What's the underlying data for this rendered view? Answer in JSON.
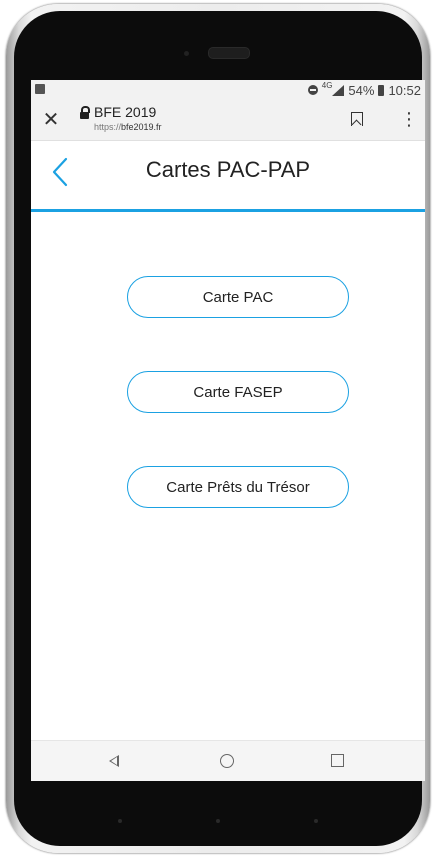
{
  "status_bar": {
    "network": "4G",
    "battery": "54%",
    "time": "10:52"
  },
  "browser": {
    "site_title": "BFE 2019",
    "url_prefix": "https://",
    "url_domain": "bfe2019.fr",
    "close_icon": "close-icon",
    "menu_icon": "more-vert-icon"
  },
  "header": {
    "title": "Cartes PAC-PAP",
    "back_icon": "chevron-left-icon"
  },
  "buttons": [
    {
      "label": "Carte PAC"
    },
    {
      "label": "Carte FASEP"
    },
    {
      "label": "Carte Prêts du Trésor"
    }
  ],
  "colors": {
    "accent": "#1ba1e2"
  }
}
